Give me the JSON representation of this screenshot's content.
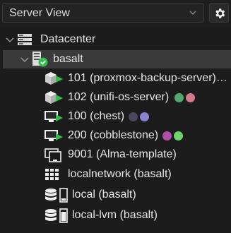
{
  "toolbar": {
    "view_select": "Server View",
    "view_chevron_icon": "chevron-down-icon",
    "settings_icon": "gear-icon"
  },
  "tree": {
    "datacenter": {
      "label": "Datacenter",
      "icon": "server-rack-icon"
    },
    "node": {
      "label": "basalt",
      "icon": "server-online-icon"
    },
    "guests": [
      {
        "label": "101 (proxmox-backup-server)…",
        "icon": "container-running-icon",
        "tags": []
      },
      {
        "label": "102 (unifi-os-server)",
        "icon": "container-running-icon",
        "tags": [
          "#52a86f",
          "#d17a8c"
        ]
      },
      {
        "label": "100 (chest)",
        "icon": "vm-running-icon",
        "tags": [
          "#4b4560",
          "#8a83d0"
        ]
      },
      {
        "label": "200 (cobblestone)",
        "icon": "vm-running-icon",
        "tags": [
          "#b14fa8",
          "#6fd46a"
        ]
      },
      {
        "label": "9001 (Alma-template)",
        "icon": "template-icon",
        "tags": []
      },
      {
        "label": "localnetwork (basalt)",
        "icon": "network-grid-icon",
        "tags": []
      },
      {
        "label": "local (basalt)",
        "icon": "storage-icon",
        "tags": []
      },
      {
        "label": "local-lvm (basalt)",
        "icon": "storage-icon",
        "tags": []
      }
    ]
  },
  "colors": {
    "background": "#1c1c1c",
    "selected_row": "#3a3a3a",
    "running_green": "#2fbf4a",
    "text": "#e6e6e6"
  }
}
